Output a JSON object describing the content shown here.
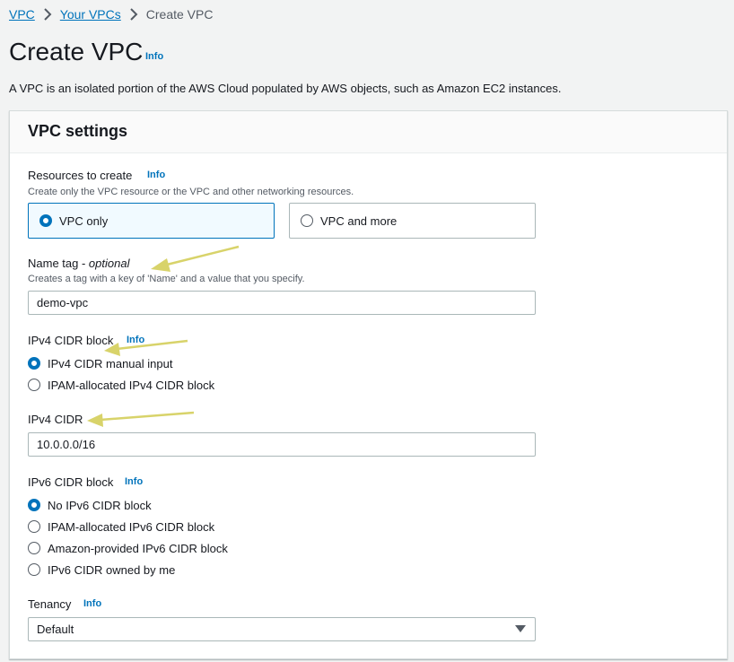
{
  "breadcrumb": {
    "items": [
      {
        "label": "VPC"
      },
      {
        "label": "Your VPCs"
      }
    ],
    "current": "Create VPC"
  },
  "header": {
    "title": "Create VPC",
    "info": "Info",
    "description": "A VPC is an isolated portion of the AWS Cloud populated by AWS objects, such as Amazon EC2 instances."
  },
  "settings": {
    "title": "VPC settings",
    "resources": {
      "label": "Resources to create",
      "info": "Info",
      "description": "Create only the VPC resource or the VPC and other networking resources.",
      "options": [
        {
          "label": "VPC only",
          "selected": true
        },
        {
          "label": "VPC and more",
          "selected": false
        }
      ]
    },
    "name_tag": {
      "label": "Name tag - ",
      "optional": "optional",
      "description": "Creates a tag with a key of 'Name' and a value that you specify.",
      "value": "demo-vpc"
    },
    "ipv4_block": {
      "label": "IPv4 CIDR block",
      "info": "Info",
      "options": [
        {
          "label": "IPv4 CIDR manual input",
          "selected": true
        },
        {
          "label": "IPAM-allocated IPv4 CIDR block",
          "selected": false
        }
      ]
    },
    "ipv4_cidr": {
      "label": "IPv4 CIDR",
      "value": "10.0.0.0/16"
    },
    "ipv6_block": {
      "label": "IPv6 CIDR block",
      "info": "Info",
      "options": [
        {
          "label": "No IPv6 CIDR block",
          "selected": true
        },
        {
          "label": "IPAM-allocated IPv6 CIDR block",
          "selected": false
        },
        {
          "label": "Amazon-provided IPv6 CIDR block",
          "selected": false
        },
        {
          "label": "IPv6 CIDR owned by me",
          "selected": false
        }
      ]
    },
    "tenancy": {
      "label": "Tenancy",
      "info": "Info",
      "value": "Default"
    }
  },
  "colors": {
    "link": "#0073bb",
    "annotation_arrow": "#d8d36a"
  },
  "icons": {
    "breadcrumb_separator": "chevron-right-icon",
    "select_caret": "caret-down-icon"
  }
}
